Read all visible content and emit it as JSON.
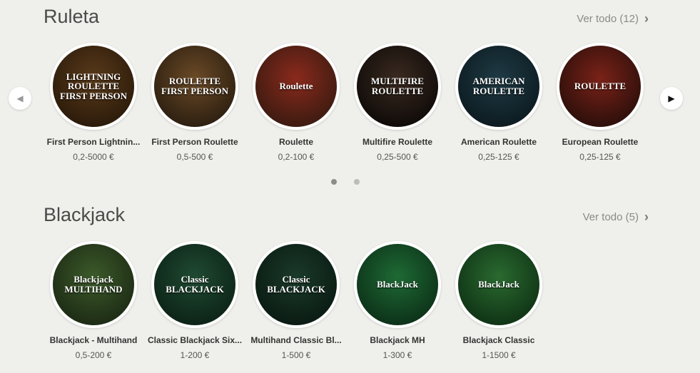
{
  "ruleta": {
    "title": "Ruleta",
    "see_all": "Ver todo (12)",
    "games": [
      {
        "name": "First Person Lightnin...",
        "limits": "0,2-5000 €",
        "art": "LIGHTNING\nROULETTE\nFIRST PERSON",
        "colors": [
          "#5a3a1a",
          "#2a1a0a"
        ]
      },
      {
        "name": "First Person Roulette",
        "limits": "0,5-500 €",
        "art": "ROULETTE\nFIRST PERSON",
        "colors": [
          "#6b4a26",
          "#2b1e10"
        ]
      },
      {
        "name": "Roulette",
        "limits": "0,2-100 €",
        "art": "Roulette",
        "colors": [
          "#8a2a1c",
          "#3a1a10"
        ]
      },
      {
        "name": "Multifire Roulette",
        "limits": "0,25-500 €",
        "art": "MULTIFIRE\nROULETTE",
        "colors": [
          "#3a2a20",
          "#0e0a08"
        ]
      },
      {
        "name": "American Roulette",
        "limits": "0,25-125 €",
        "art": "AMERICAN\nROULETTE",
        "colors": [
          "#1f3a44",
          "#0c1a20"
        ]
      },
      {
        "name": "European Roulette",
        "limits": "0,25-125 €",
        "art": "ROULETTE",
        "colors": [
          "#7a2218",
          "#2a0e0a"
        ]
      }
    ],
    "pagination": [
      "1",
      "2"
    ]
  },
  "blackjack": {
    "title": "Blackjack",
    "see_all": "Ver todo (5)",
    "games": [
      {
        "name": "Blackjack - Multihand",
        "limits": "0,5-200 €",
        "art": "Blackjack\nMULTIHAND",
        "colors": [
          "#3c5a2a",
          "#1c2a14"
        ]
      },
      {
        "name": "Classic Blackjack Six...",
        "limits": "1-200 €",
        "art": "Classic\nBLACKJACK",
        "colors": [
          "#1f4a32",
          "#0c2216"
        ]
      },
      {
        "name": "Multihand Classic Bl...",
        "limits": "1-500 €",
        "art": "Classic\nBLACKJACK",
        "colors": [
          "#1a3a2a",
          "#0a1a12"
        ]
      },
      {
        "name": "Blackjack MH",
        "limits": "1-300 €",
        "art": "BlackJack",
        "colors": [
          "#1e6a34",
          "#0c3018"
        ]
      },
      {
        "name": "Blackjack Classic",
        "limits": "1-1500 €",
        "art": "BlackJack",
        "colors": [
          "#2a6a30",
          "#0f3214"
        ]
      }
    ]
  },
  "icons": {
    "prev": "◀",
    "next": "▶",
    "chevron": "›"
  },
  "colors": {
    "background": "#efefeb",
    "title": "#4a4a4a",
    "link": "#8a8a8a"
  }
}
